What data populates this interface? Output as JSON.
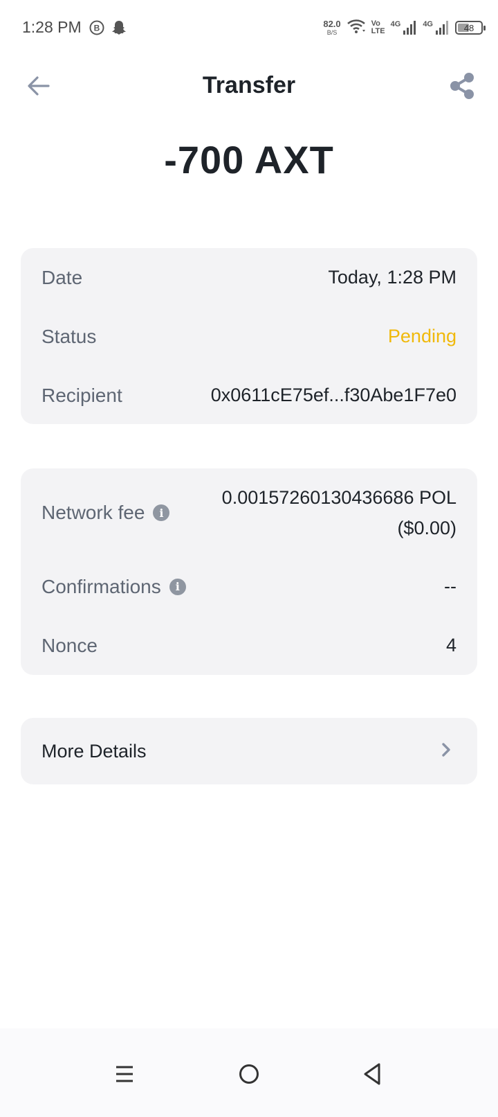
{
  "status_bar": {
    "time": "1:28 PM",
    "speed_value": "82.0",
    "speed_unit": "B/S",
    "volte_top": "Vo",
    "volte_bottom": "LTE",
    "sim1_label": "4G",
    "sim2_label": "4G",
    "battery": "48",
    "battery_level": 0.48,
    "icons": [
      "bitcoin-circle-icon",
      "snapchat-ghost-icon",
      "wifi-icon",
      "signal-icon",
      "battery-icon"
    ]
  },
  "header": {
    "title": "Transfer",
    "back_icon": "arrow-left-icon",
    "share_icon": "share-icon"
  },
  "amount": "-700 AXT",
  "details": {
    "date_label": "Date",
    "date_value": "Today, 1:28 PM",
    "status_label": "Status",
    "status_value": "Pending",
    "recipient_label": "Recipient",
    "recipient_value": "0x0611cE75ef...f30Abe1F7e0"
  },
  "fees": {
    "network_fee_label": "Network fee",
    "network_fee_value": "0.00157260130436686 POL",
    "network_fee_usd": "($0.00)",
    "confirmations_label": "Confirmations",
    "confirmations_value": "--",
    "nonce_label": "Nonce",
    "nonce_value": "4"
  },
  "more_details": {
    "label": "More Details"
  },
  "colors": {
    "accent_pending": "#f0b90b",
    "card_bg": "#f3f3f5",
    "text_primary": "#1e2329",
    "text_secondary": "#5e6673"
  }
}
